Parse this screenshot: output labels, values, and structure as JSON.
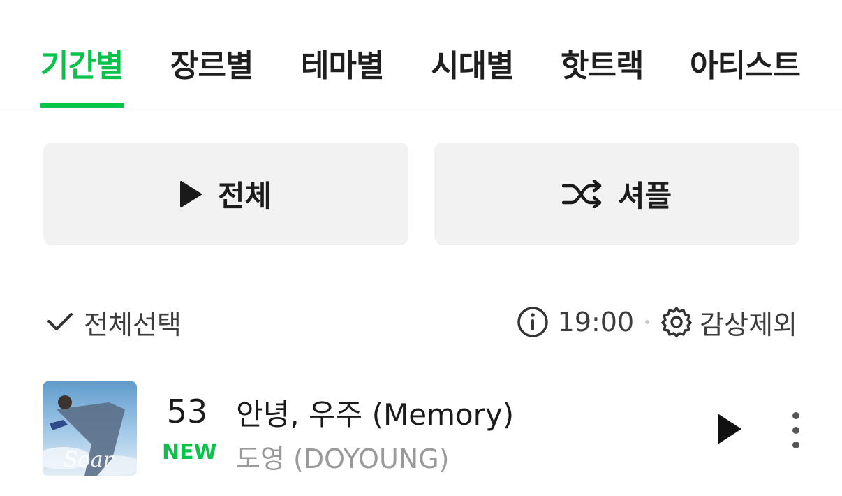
{
  "tabs": [
    {
      "label": "기간별",
      "active": true
    },
    {
      "label": "장르별",
      "active": false
    },
    {
      "label": "테마별",
      "active": false
    },
    {
      "label": "시대별",
      "active": false
    },
    {
      "label": "핫트랙",
      "active": false
    },
    {
      "label": "아티스트",
      "active": false
    }
  ],
  "actions": {
    "play_all_label": "전체",
    "shuffle_label": "셔플"
  },
  "toolbar": {
    "select_all_label": "전체선택",
    "time": "19:00",
    "exclude_label": "감상제외"
  },
  "songs": [
    {
      "rank": "53",
      "badge": "NEW",
      "title": "안녕, 우주 (Memory)",
      "artist": "도영 (DOYOUNG)",
      "cover_text": "Soar"
    }
  ],
  "colors": {
    "accent": "#08c34a",
    "button_bg": "#f2f2f2",
    "secondary_text": "#9a9a9a"
  },
  "icons": {
    "play": "play-icon",
    "shuffle": "shuffle-icon",
    "check": "check-icon",
    "info": "info-icon",
    "gear": "gear-icon",
    "more": "more-vertical-icon"
  }
}
